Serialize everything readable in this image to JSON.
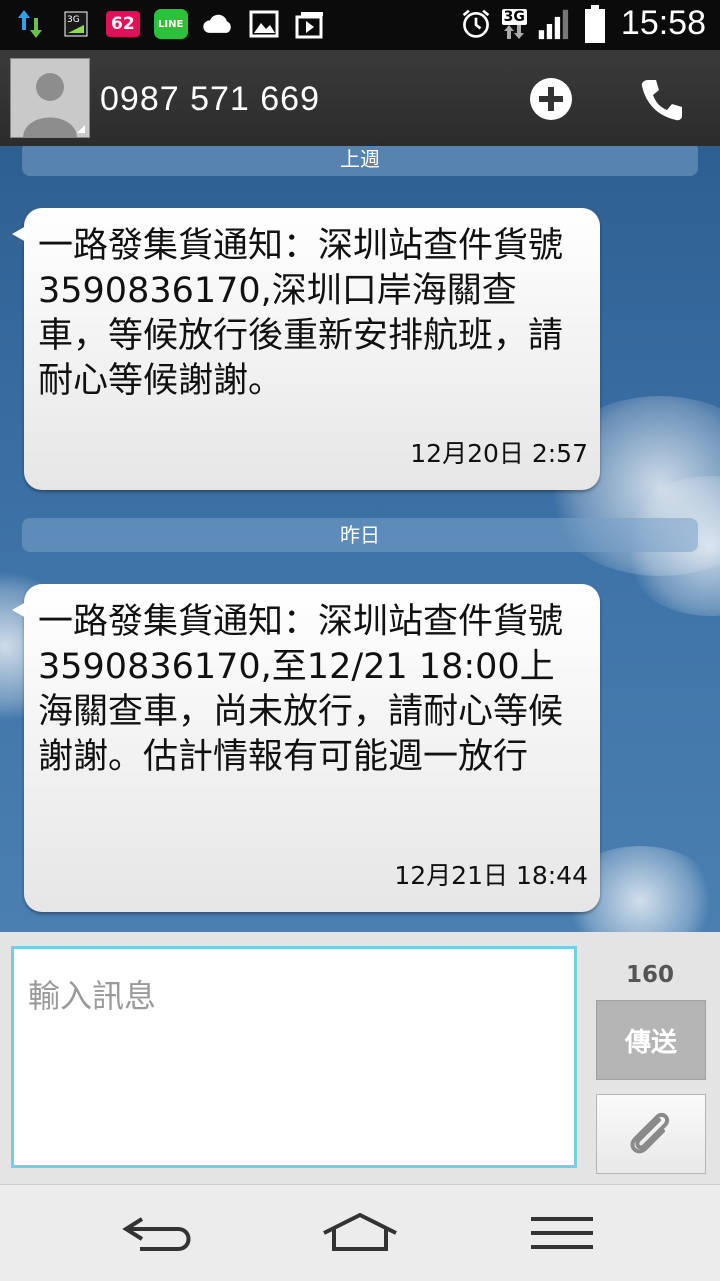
{
  "status_bar": {
    "notification_count": "62",
    "line_label": "LINE",
    "network_type": "3G",
    "network_type_sim": "3G",
    "time": "15:58"
  },
  "header": {
    "contact_number": "0987 571 669"
  },
  "messages": [
    {
      "date_header": "上週",
      "text": "一路發集貨通知：深圳站查件貨號3590836170,深圳口岸海關查車，等候放行後重新安排航班，請耐心等候謝謝。",
      "timestamp": "12月20日 2:57"
    },
    {
      "date_header": "昨日",
      "text": "一路發集貨通知：深圳站查件貨號3590836170,至12/21 18:00上海關查車，尚未放行，請耐心等候謝謝。估計情報有可能週一放行",
      "timestamp": "12月21日 18:44"
    }
  ],
  "composer": {
    "placeholder": "輸入訊息",
    "char_count": "160",
    "send_label": "傳送"
  },
  "colors": {
    "input_border": "#6fd0e6",
    "conversation_bg": "#3f74a8"
  }
}
